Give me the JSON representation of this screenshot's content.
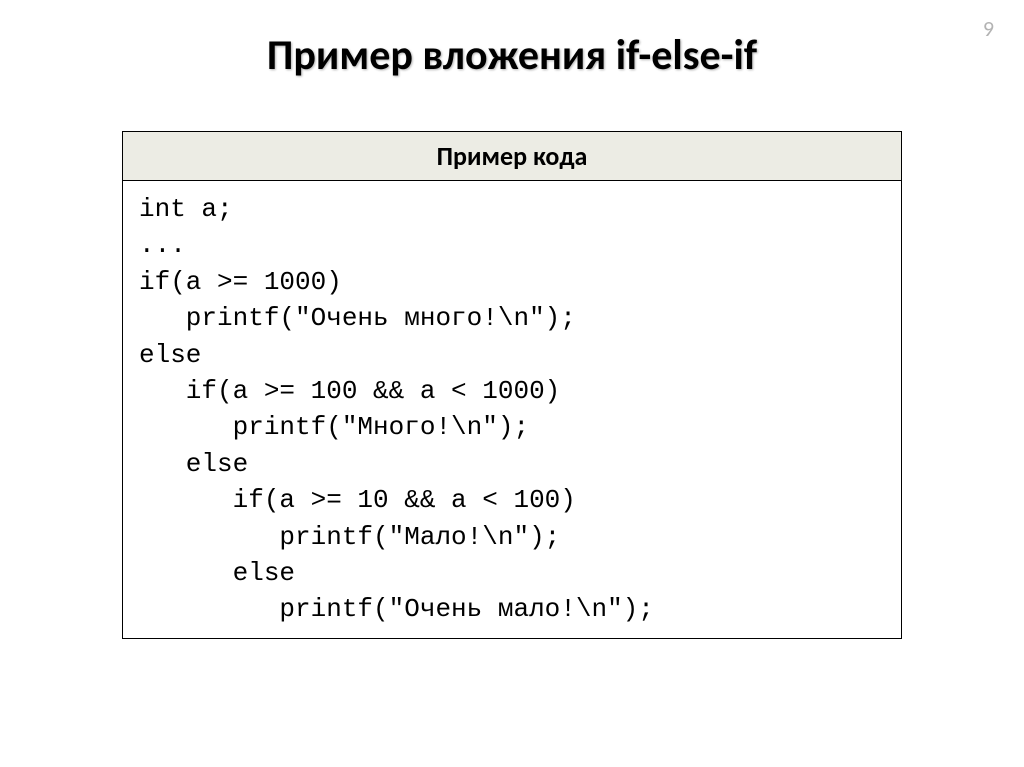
{
  "page_number": "9",
  "title": "Пример вложения if-else-if",
  "code_table": {
    "header": "Пример кода",
    "lines": [
      "int a;",
      "...",
      "if(a >= 1000)",
      "   printf(\"Очень много!\\n\");",
      "else",
      "   if(a >= 100 && a < 1000)",
      "      printf(\"Много!\\n\");",
      "   else",
      "      if(a >= 10 && a < 100)",
      "         printf(\"Мало!\\n\");",
      "      else",
      "         printf(\"Очень мало!\\n\");"
    ]
  }
}
